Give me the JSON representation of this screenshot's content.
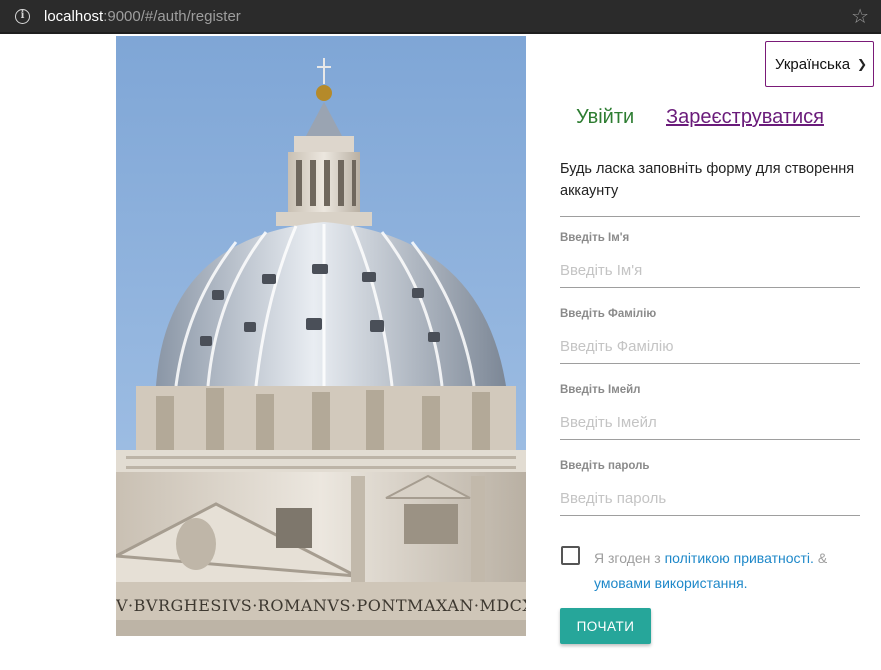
{
  "browser": {
    "url_host": "localhost",
    "url_rest": ":9000/#/auth/register"
  },
  "hero": {
    "inscription": "V·BVRGHESIVS·ROMANVS·PONTMAXAN·MDCX"
  },
  "language": {
    "selected": "Українська"
  },
  "tabs": {
    "login": "Увійти",
    "register": "Зареєструватися"
  },
  "form": {
    "intro": "Будь ласка заповніть форму для створення аккаунту",
    "first_name": {
      "label": "Введіть Ім'я",
      "placeholder": "Введіть Ім'я"
    },
    "last_name": {
      "label": "Введіть Фамілію",
      "placeholder": "Введіть Фамілію"
    },
    "email": {
      "label": "Введіть Імейл",
      "placeholder": "Введіть Імейл"
    },
    "password": {
      "label": "Введіть пароль",
      "placeholder": "Введіть пароль"
    },
    "agree_prefix": "Я згоден з",
    "privacy_link": "політикою приватності.",
    "agree_amp": "&",
    "terms_link": "умовами використання.",
    "submit": "ПОЧАТИ"
  },
  "colors": {
    "accent_teal": "#26a69a",
    "login_tab": "#2e7d32",
    "register_tab": "#6a1b7a",
    "link": "#1e88c9"
  }
}
